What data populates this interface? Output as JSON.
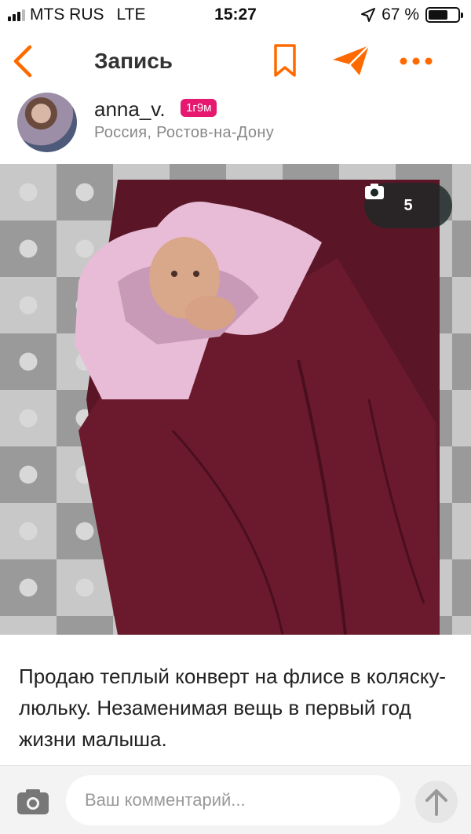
{
  "status_bar": {
    "carrier": "MTS RUS",
    "network": "LTE",
    "time": "15:27",
    "battery": "67 %",
    "battery_level": 0.67
  },
  "nav": {
    "title": "Запись",
    "accent": "#ff6a00"
  },
  "author": {
    "name": "anna_v.",
    "badge": "1г9м",
    "location": "Россия, Ростов-на-Дону"
  },
  "photo": {
    "count": "5"
  },
  "post": {
    "text": "Продаю теплый конверт на флисе в коляску-люльку. Незаменимая вещь в первый год жизни малыша."
  },
  "comment": {
    "placeholder": "Ваш комментарий..."
  }
}
